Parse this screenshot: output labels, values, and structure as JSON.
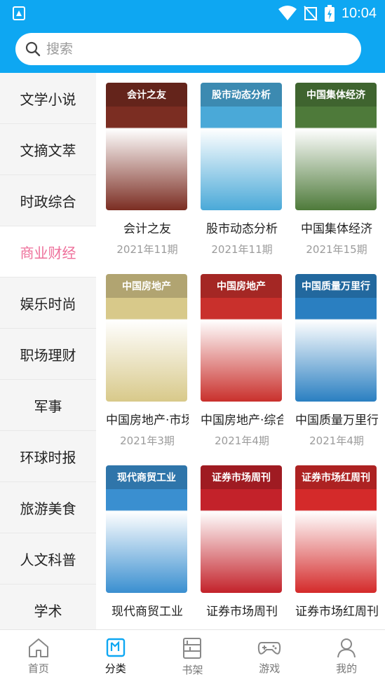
{
  "status": {
    "time": "10:04"
  },
  "search": {
    "placeholder": "搜索"
  },
  "sidebar": {
    "items": [
      {
        "label": "文学小说"
      },
      {
        "label": "文摘文萃"
      },
      {
        "label": "时政综合"
      },
      {
        "label": "商业财经",
        "active": true
      },
      {
        "label": "娱乐时尚"
      },
      {
        "label": "职场理财"
      },
      {
        "label": "军事"
      },
      {
        "label": "环球时报"
      },
      {
        "label": "旅游美食"
      },
      {
        "label": "人文科普"
      },
      {
        "label": "学术"
      }
    ]
  },
  "magazines": [
    {
      "title": "会计之友",
      "issue": "2021年11期",
      "cover_color": "#7b2d22",
      "masthead": "会计之友"
    },
    {
      "title": "股市动态分析",
      "issue": "2021年11期",
      "cover_color": "#4aa9d8",
      "masthead": "股市动态分析"
    },
    {
      "title": "中国集体经济",
      "issue": "2021年15期",
      "cover_color": "#4e7a3a",
      "masthead": "中国集体经济"
    },
    {
      "title": "中国房地产·市场",
      "issue": "2021年3期",
      "cover_color": "#d8c98a",
      "masthead": "中国房地产"
    },
    {
      "title": "中国房地产·综合",
      "issue": "2021年4期",
      "cover_color": "#c9302c",
      "masthead": "中国房地产"
    },
    {
      "title": "中国质量万里行",
      "issue": "2021年4期",
      "cover_color": "#2a7fc1",
      "masthead": "中国质量万里行"
    },
    {
      "title": "现代商贸工业",
      "issue": "",
      "cover_color": "#3a8fd0",
      "masthead": "现代商贸工业"
    },
    {
      "title": "证券市场周刊",
      "issue": "",
      "cover_color": "#c3222a",
      "masthead": "证券市场周刊"
    },
    {
      "title": "证券市场红周刊",
      "issue": "",
      "cover_color": "#d42a2a",
      "masthead": "证券市场红周刊"
    }
  ],
  "tabs": [
    {
      "label": "首页",
      "icon": "home-icon"
    },
    {
      "label": "分类",
      "icon": "category-icon",
      "active": true
    },
    {
      "label": "书架",
      "icon": "bookshelf-icon"
    },
    {
      "label": "游戏",
      "icon": "gamepad-icon"
    },
    {
      "label": "我的",
      "icon": "profile-icon"
    }
  ],
  "colors": {
    "accent": "#0ea7f2",
    "active_category": "#ee6f9a"
  }
}
